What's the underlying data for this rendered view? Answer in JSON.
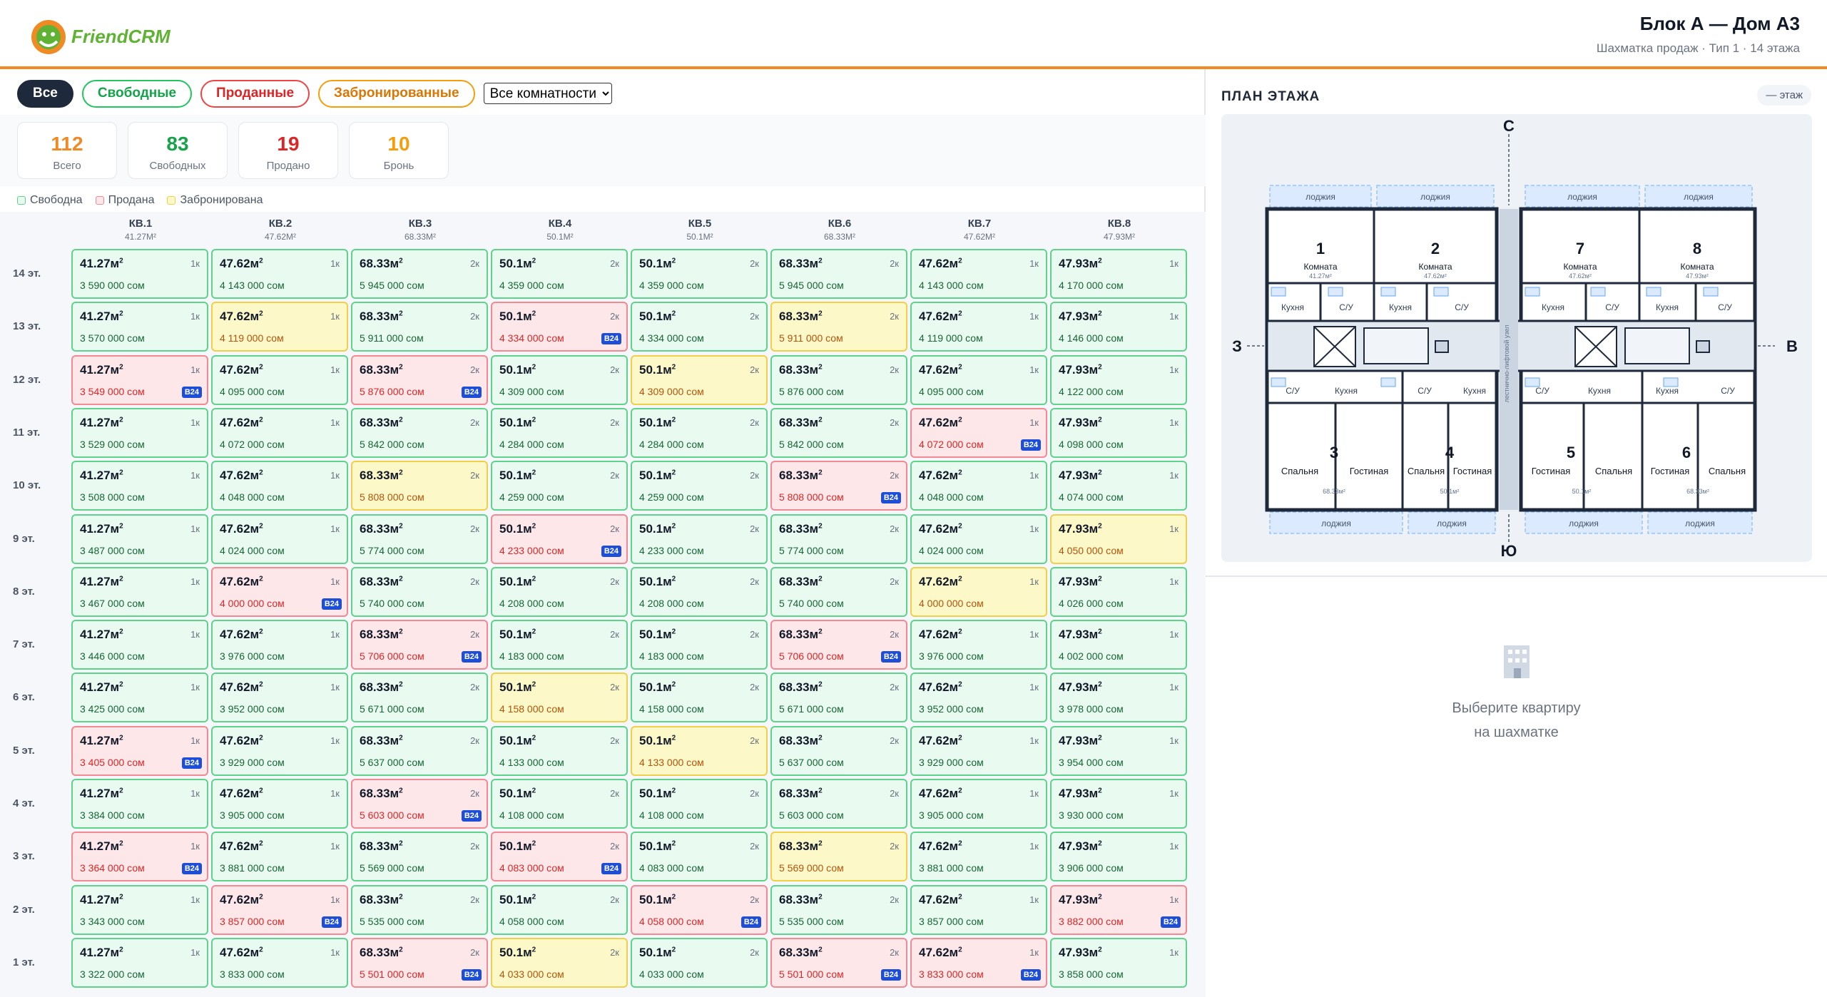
{
  "app": {
    "logo_text": "FriendCRM"
  },
  "header": {
    "title": "Блок А — Дом А3",
    "subtitle": "Шахматка продаж · Тип 1 · 14 этажа"
  },
  "filters": {
    "all": "Все",
    "free": "Свободные",
    "sold": "Проданные",
    "reserved": "Забронированные",
    "rooms_selected": "Все комнатности"
  },
  "stats": [
    {
      "num": "112",
      "label": "Всего",
      "color": "#f08a24"
    },
    {
      "num": "83",
      "label": "Свободных",
      "color": "#16a34a"
    },
    {
      "num": "19",
      "label": "Продано",
      "color": "#dc2626"
    },
    {
      "num": "10",
      "label": "Бронь",
      "color": "#f59e0b"
    }
  ],
  "legend": {
    "free": "Свободна",
    "sold": "Продана",
    "reserved": "Забронирована"
  },
  "columns": [
    {
      "name": "КВ.1",
      "area": "41.27М²",
      "a": "41.27",
      "rooms": "1к"
    },
    {
      "name": "КВ.2",
      "area": "47.62М²",
      "a": "47.62",
      "rooms": "1к"
    },
    {
      "name": "КВ.3",
      "area": "68.33М²",
      "a": "68.33",
      "rooms": "2к"
    },
    {
      "name": "КВ.4",
      "area": "50.1М²",
      "a": "50.1",
      "rooms": "2к"
    },
    {
      "name": "КВ.5",
      "area": "50.1М²",
      "a": "50.1",
      "rooms": "2к"
    },
    {
      "name": "КВ.6",
      "area": "68.33М²",
      "a": "68.33",
      "rooms": "2к"
    },
    {
      "name": "КВ.7",
      "area": "47.62М²",
      "a": "47.62",
      "rooms": "1к"
    },
    {
      "name": "КВ.8",
      "area": "47.93М²",
      "a": "47.93",
      "rooms": "1к"
    }
  ],
  "b24_label": "B24",
  "floors": [
    {
      "label": "14 эт.",
      "cells": [
        [
          "3 590 000 сом",
          "F"
        ],
        [
          "4 143 000 сом",
          "F"
        ],
        [
          "5 945 000 сом",
          "F"
        ],
        [
          "4 359 000 сом",
          "F"
        ],
        [
          "4 359 000 сом",
          "F"
        ],
        [
          "5 945 000 сом",
          "F"
        ],
        [
          "4 143 000 сом",
          "F"
        ],
        [
          "4 170 000 сом",
          "F"
        ]
      ]
    },
    {
      "label": "13 эт.",
      "cells": [
        [
          "3 570 000 сом",
          "F"
        ],
        [
          "4 119 000 сом",
          "R"
        ],
        [
          "5 911 000 сом",
          "F"
        ],
        [
          "4 334 000 сом",
          "S"
        ],
        [
          "4 334 000 сом",
          "F"
        ],
        [
          "5 911 000 сом",
          "R"
        ],
        [
          "4 119 000 сом",
          "F"
        ],
        [
          "4 146 000 сом",
          "F"
        ]
      ]
    },
    {
      "label": "12 эт.",
      "cells": [
        [
          "3 549 000 сом",
          "S"
        ],
        [
          "4 095 000 сом",
          "F"
        ],
        [
          "5 876 000 сом",
          "S"
        ],
        [
          "4 309 000 сом",
          "F"
        ],
        [
          "4 309 000 сом",
          "R"
        ],
        [
          "5 876 000 сом",
          "F"
        ],
        [
          "4 095 000 сом",
          "F"
        ],
        [
          "4 122 000 сом",
          "F"
        ]
      ]
    },
    {
      "label": "11 эт.",
      "cells": [
        [
          "3 529 000 сом",
          "F"
        ],
        [
          "4 072 000 сом",
          "F"
        ],
        [
          "5 842 000 сом",
          "F"
        ],
        [
          "4 284 000 сом",
          "F"
        ],
        [
          "4 284 000 сом",
          "F"
        ],
        [
          "5 842 000 сом",
          "F"
        ],
        [
          "4 072 000 сом",
          "S"
        ],
        [
          "4 098 000 сом",
          "F"
        ]
      ]
    },
    {
      "label": "10 эт.",
      "cells": [
        [
          "3 508 000 сом",
          "F"
        ],
        [
          "4 048 000 сом",
          "F"
        ],
        [
          "5 808 000 сом",
          "R"
        ],
        [
          "4 259 000 сом",
          "F"
        ],
        [
          "4 259 000 сом",
          "F"
        ],
        [
          "5 808 000 сом",
          "S"
        ],
        [
          "4 048 000 сом",
          "F"
        ],
        [
          "4 074 000 сом",
          "F"
        ]
      ]
    },
    {
      "label": "9 эт.",
      "cells": [
        [
          "3 487 000 сом",
          "F"
        ],
        [
          "4 024 000 сом",
          "F"
        ],
        [
          "5 774 000 сом",
          "F"
        ],
        [
          "4 233 000 сом",
          "S"
        ],
        [
          "4 233 000 сом",
          "F"
        ],
        [
          "5 774 000 сом",
          "F"
        ],
        [
          "4 024 000 сом",
          "F"
        ],
        [
          "4 050 000 сом",
          "R"
        ]
      ]
    },
    {
      "label": "8 эт.",
      "cells": [
        [
          "3 467 000 сом",
          "F"
        ],
        [
          "4 000 000 сом",
          "S"
        ],
        [
          "5 740 000 сом",
          "F"
        ],
        [
          "4 208 000 сом",
          "F"
        ],
        [
          "4 208 000 сом",
          "F"
        ],
        [
          "5 740 000 сом",
          "F"
        ],
        [
          "4 000 000 сом",
          "R"
        ],
        [
          "4 026 000 сом",
          "F"
        ]
      ]
    },
    {
      "label": "7 эт.",
      "cells": [
        [
          "3 446 000 сом",
          "F"
        ],
        [
          "3 976 000 сом",
          "F"
        ],
        [
          "5 706 000 сом",
          "S"
        ],
        [
          "4 183 000 сом",
          "F"
        ],
        [
          "4 183 000 сом",
          "F"
        ],
        [
          "5 706 000 сом",
          "S"
        ],
        [
          "3 976 000 сом",
          "F"
        ],
        [
          "4 002 000 сом",
          "F"
        ]
      ]
    },
    {
      "label": "6 эт.",
      "cells": [
        [
          "3 425 000 сом",
          "F"
        ],
        [
          "3 952 000 сом",
          "F"
        ],
        [
          "5 671 000 сом",
          "F"
        ],
        [
          "4 158 000 сом",
          "R"
        ],
        [
          "4 158 000 сом",
          "F"
        ],
        [
          "5 671 000 сом",
          "F"
        ],
        [
          "3 952 000 сом",
          "F"
        ],
        [
          "3 978 000 сом",
          "F"
        ]
      ]
    },
    {
      "label": "5 эт.",
      "cells": [
        [
          "3 405 000 сом",
          "S"
        ],
        [
          "3 929 000 сом",
          "F"
        ],
        [
          "5 637 000 сом",
          "F"
        ],
        [
          "4 133 000 сом",
          "F"
        ],
        [
          "4 133 000 сом",
          "R"
        ],
        [
          "5 637 000 сом",
          "F"
        ],
        [
          "3 929 000 сом",
          "F"
        ],
        [
          "3 954 000 сом",
          "F"
        ]
      ]
    },
    {
      "label": "4 эт.",
      "cells": [
        [
          "3 384 000 сом",
          "F"
        ],
        [
          "3 905 000 сом",
          "F"
        ],
        [
          "5 603 000 сом",
          "S"
        ],
        [
          "4 108 000 сом",
          "F"
        ],
        [
          "4 108 000 сом",
          "F"
        ],
        [
          "5 603 000 сом",
          "F"
        ],
        [
          "3 905 000 сом",
          "F"
        ],
        [
          "3 930 000 сом",
          "F"
        ]
      ]
    },
    {
      "label": "3 эт.",
      "cells": [
        [
          "3 364 000 сом",
          "S"
        ],
        [
          "3 881 000 сом",
          "F"
        ],
        [
          "5 569 000 сом",
          "F"
        ],
        [
          "4 083 000 сом",
          "S"
        ],
        [
          "4 083 000 сом",
          "F"
        ],
        [
          "5 569 000 сом",
          "R"
        ],
        [
          "3 881 000 сом",
          "F"
        ],
        [
          "3 906 000 сом",
          "F"
        ]
      ]
    },
    {
      "label": "2 эт.",
      "cells": [
        [
          "3 343 000 сом",
          "F"
        ],
        [
          "3 857 000 сом",
          "S"
        ],
        [
          "5 535 000 сом",
          "F"
        ],
        [
          "4 058 000 сом",
          "F"
        ],
        [
          "4 058 000 сом",
          "S"
        ],
        [
          "5 535 000 сом",
          "F"
        ],
        [
          "3 857 000 сом",
          "F"
        ],
        [
          "3 882 000 сом",
          "S"
        ]
      ]
    },
    {
      "label": "1 эт.",
      "cells": [
        [
          "3 322 000 сом",
          "F"
        ],
        [
          "3 833 000 сом",
          "F"
        ],
        [
          "5 501 000 сом",
          "S"
        ],
        [
          "4 033 000 сом",
          "R"
        ],
        [
          "4 033 000 сом",
          "F"
        ],
        [
          "5 501 000 сом",
          "S"
        ],
        [
          "3 833 000 сом",
          "S"
        ],
        [
          "3 858 000 сом",
          "F"
        ]
      ]
    }
  ],
  "plan": {
    "title": "ПЛАН ЭТАЖА",
    "floor_chip": "— этаж",
    "compass": {
      "n": "С",
      "s": "Ю",
      "w": "З",
      "e": "В"
    },
    "loggia": "лоджия",
    "corridor": "лестнично-лифтовой узел",
    "top_apts": [
      {
        "num": "1",
        "label": "Комната",
        "area": "41.27м²"
      },
      {
        "num": "2",
        "label": "Комната",
        "area": "47.62м²"
      },
      {
        "num": "7",
        "label": "Комната",
        "area": "47.62м²"
      },
      {
        "num": "8",
        "label": "Комната",
        "area": "47.93м²"
      }
    ],
    "bottom_apts": [
      {
        "num": "3",
        "r1": "Спальня",
        "r2": "Гостиная",
        "area": "68.33м²"
      },
      {
        "num": "4",
        "r1": "Спальня",
        "r2": "Гостиная",
        "area": "50.1м²"
      },
      {
        "num": "5",
        "r1": "Гостиная",
        "r2": "Спальня",
        "area": "50.1м²"
      },
      {
        "num": "6",
        "r1": "Гостиная",
        "r2": "Спальня",
        "area": "68.33м²"
      }
    ],
    "kitchen": "Кухня",
    "bath": "С/У"
  },
  "empty_state": {
    "line1": "Выберите квартиру",
    "line2": "на шахматке"
  }
}
